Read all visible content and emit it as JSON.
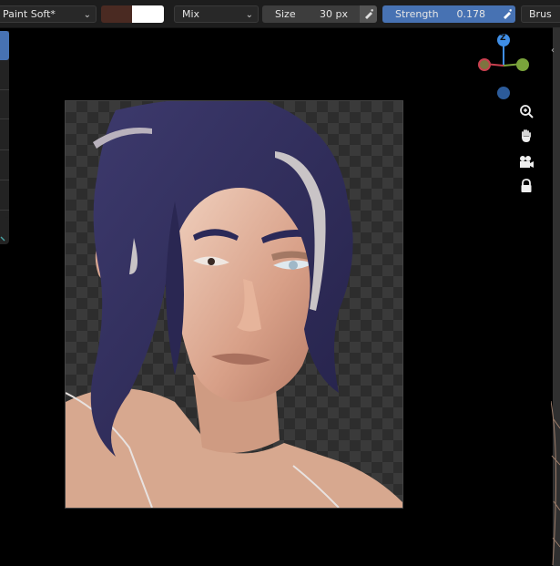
{
  "toolbar": {
    "brush_name": "Paint Soft*",
    "color_primary": "#4a2a22",
    "color_secondary": "#ffffff",
    "blend_mode": "Mix",
    "size_label": "Size",
    "size_value": "30 px",
    "strength_label": "Strength",
    "strength_value": "0.178",
    "brush_menu": "Brus"
  },
  "gizmo": {
    "z_label": "Z"
  },
  "nav": {
    "icons": [
      "zoom-icon",
      "hand-icon",
      "camera-icon",
      "lock-icon"
    ]
  }
}
